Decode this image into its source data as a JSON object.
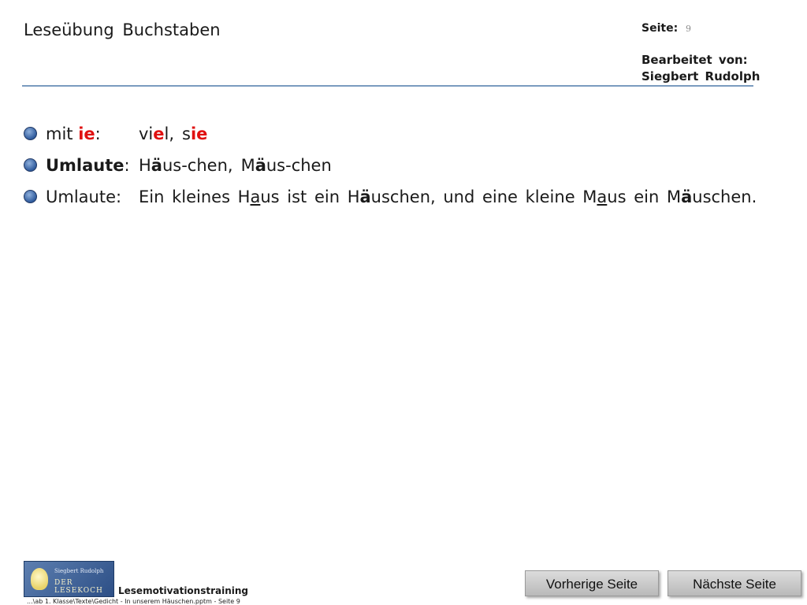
{
  "header": {
    "title": "Leseübung  Buchstaben",
    "page_label": "Seite:",
    "page_number": "9",
    "editor_label": "Bearbeitet  von:",
    "editor_name": "Siegbert  Rudolph"
  },
  "rows": [
    {
      "label_pre": "mit  ",
      "label_em": "ie",
      "label_post": ":",
      "words": [
        {
          "a": "vi",
          "b": "e",
          "c": "l,"
        },
        {
          "a": "s",
          "b": "ie",
          "c": ""
        }
      ]
    },
    {
      "label": "Umlaute",
      "label_post": ":",
      "words": [
        {
          "a": "H",
          "b": "ä",
          "c": "us-chen,"
        },
        {
          "a": "M",
          "b": "ä",
          "c": "us-chen"
        }
      ]
    },
    {
      "label": "Umlaute:",
      "s1": "Ein  kleines  H",
      "u1": "a",
      "s2": "us  ist  ein  H",
      "b1": "ä",
      "s3": "uschen,  und  eine  kleine  M",
      "u2": "a",
      "s4": "us  ein  M",
      "b2": "ä",
      "s5": "uschen."
    }
  ],
  "footer": {
    "logo_top": "Siegbert Rudolph",
    "logo_main": "DER LESEKOCH",
    "brand": "Lesemotivationstraining",
    "path": "...\\ab 1. Klasse\\Texte\\Gedicht - In unserem Häuschen.pptm - Seite 9"
  },
  "nav": {
    "prev": "Vorherige Seite",
    "next": "Nächste Seite"
  },
  "colors": {
    "highlight_red": "#e01010",
    "header_line": "#7a9bbf",
    "bullet": "#2f5b9d"
  }
}
